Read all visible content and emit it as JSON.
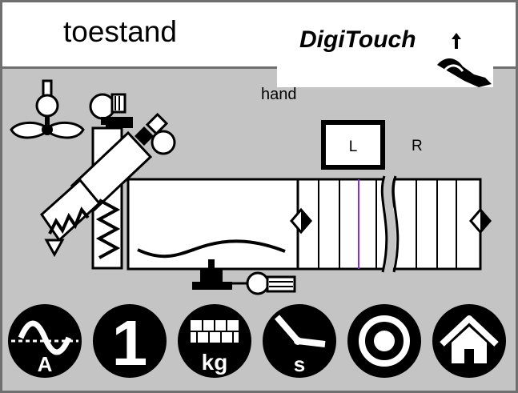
{
  "header": {
    "title": "toestand",
    "logo_text": "DigiTouch"
  },
  "status": {
    "mode": "hand"
  },
  "side_selector": {
    "left_label": "L",
    "right_label": "R",
    "selected": "L"
  },
  "toolbar": {
    "buttons": [
      {
        "icon": "ammeter-icon",
        "label": "A"
      },
      {
        "icon": "number-one-icon",
        "label": "1"
      },
      {
        "icon": "weight-kg-icon",
        "label": "kg"
      },
      {
        "icon": "clock-seconds-icon",
        "label": "s"
      },
      {
        "icon": "target-circle-icon",
        "label": ""
      },
      {
        "icon": "home-icon",
        "label": ""
      }
    ]
  },
  "colors": {
    "background": "#c4c4c4",
    "frame": "#6f6f6f",
    "header_bg": "#ffffff",
    "icon_fill": "#000000",
    "accent_line": "#8a2be2"
  }
}
